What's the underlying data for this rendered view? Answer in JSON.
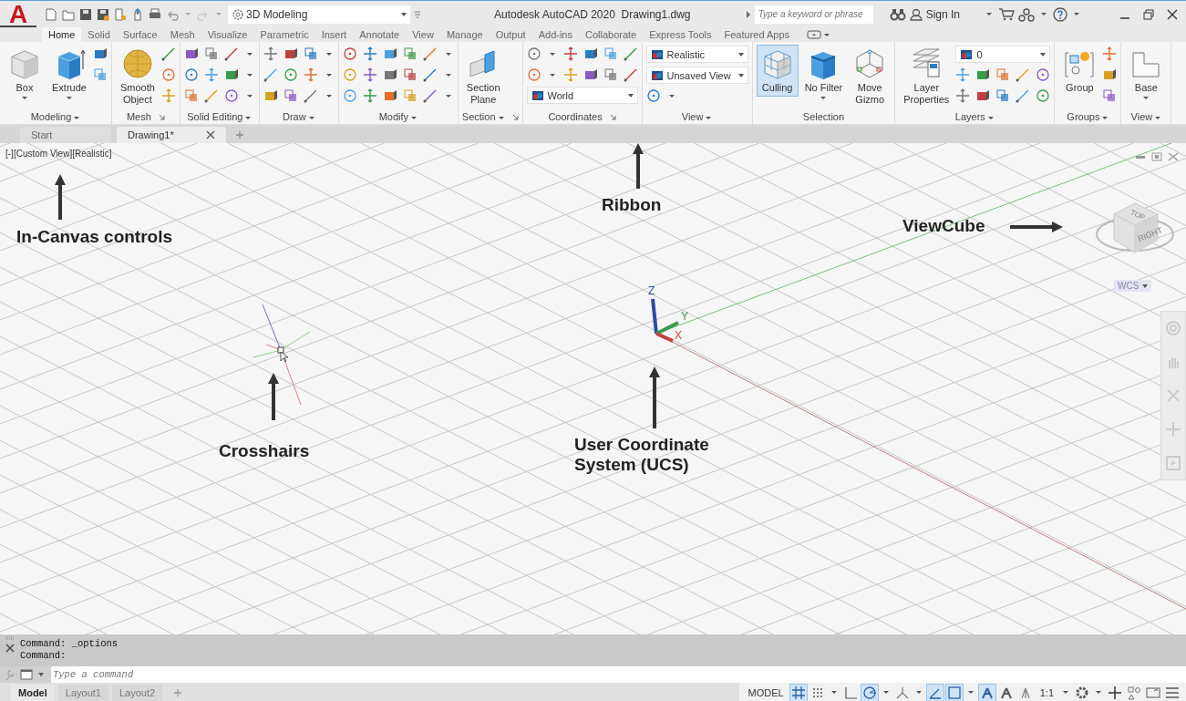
{
  "title_bar": {
    "logo": "A",
    "workspace": "3D Modeling",
    "title": "Autodesk AutoCAD 2020  Drawing1.dwg",
    "search": {
      "placeholder": "Type a keyword or phrase"
    },
    "sign_in": "Sign In"
  },
  "ribbon_tabs": [
    {
      "label": "Home",
      "selected": true
    },
    {
      "label": "Solid",
      "selected": false
    },
    {
      "label": "Surface",
      "selected": false
    },
    {
      "label": "Mesh",
      "selected": false
    },
    {
      "label": "Visualize",
      "selected": false
    },
    {
      "label": "Parametric",
      "selected": false
    },
    {
      "label": "Insert",
      "selected": false
    },
    {
      "label": "Annotate",
      "selected": false
    },
    {
      "label": "View",
      "selected": false
    },
    {
      "label": "Manage",
      "selected": false
    },
    {
      "label": "Output",
      "selected": false
    },
    {
      "label": "Add-ins",
      "selected": false
    },
    {
      "label": "Collaborate",
      "selected": false
    },
    {
      "label": "Express Tools",
      "selected": false
    },
    {
      "label": "Featured Apps",
      "selected": false
    }
  ],
  "ribbon_panels": [
    {
      "title": "Modeling",
      "dropdown": true,
      "launcher": false,
      "tools": [
        {
          "kind": "large",
          "label": "Box",
          "caret": true,
          "on": false
        },
        {
          "kind": "large",
          "label": "Extrude",
          "caret": true,
          "on": false
        },
        {
          "kind": "grid"
        }
      ]
    },
    {
      "title": "Mesh",
      "dropdown": false,
      "launcher": true,
      "tools": [
        {
          "kind": "large",
          "label": "Smooth\nObject",
          "caret": false,
          "on": false
        },
        {
          "kind": "grid"
        }
      ]
    },
    {
      "title": "Solid Editing",
      "dropdown": true,
      "launcher": false,
      "tools": [
        {
          "kind": "grid"
        }
      ]
    },
    {
      "title": "Draw",
      "dropdown": true,
      "launcher": false,
      "tools": [
        {
          "kind": "grid"
        }
      ]
    },
    {
      "title": "Modify",
      "dropdown": true,
      "launcher": false,
      "tools": [
        {
          "kind": "grid"
        }
      ]
    },
    {
      "title": "Section",
      "dropdown": true,
      "launcher": true,
      "tools": [
        {
          "kind": "large",
          "label": "Section\nPlane",
          "caret": false,
          "on": false
        }
      ]
    },
    {
      "title": "Coordinates",
      "dropdown": false,
      "launcher": true,
      "tools": [
        {
          "kind": "grid"
        },
        {
          "kind": "combo",
          "value": "World"
        }
      ]
    },
    {
      "title": "View",
      "dropdown": true,
      "launcher": false,
      "tools": [
        {
          "kind": "combo",
          "value": "Realistic"
        },
        {
          "kind": "combo",
          "value": "Unsaved View"
        },
        {
          "kind": "small"
        }
      ]
    },
    {
      "title": "Selection",
      "dropdown": false,
      "launcher": false,
      "tools": [
        {
          "kind": "large",
          "label": "Culling",
          "caret": false,
          "on": true
        },
        {
          "kind": "large",
          "label": "No Filter",
          "caret": true,
          "on": false
        },
        {
          "kind": "large",
          "label": "Move\nGizmo",
          "caret": false,
          "on": false
        }
      ]
    },
    {
      "title": "Layers",
      "dropdown": true,
      "launcher": false,
      "tools": [
        {
          "kind": "large",
          "label": "Layer\nProperties",
          "caret": false,
          "on": false
        },
        {
          "kind": "combo",
          "value": "0"
        },
        {
          "kind": "grid"
        }
      ]
    },
    {
      "title": "Groups",
      "dropdown": true,
      "launcher": false,
      "tools": [
        {
          "kind": "large",
          "label": "Group",
          "caret": false,
          "on": false
        },
        {
          "kind": "grid"
        }
      ]
    },
    {
      "title": "View",
      "dropdown": true,
      "launcher": false,
      "tools": [
        {
          "kind": "large",
          "label": "Base",
          "caret": true,
          "on": false
        }
      ]
    }
  ],
  "file_tabs": [
    {
      "label": "Start",
      "selected": false
    },
    {
      "label": "Drawing1*",
      "selected": true
    }
  ],
  "viewport": {
    "label": "[-][Custom View][Realistic]",
    "annotations": [
      {
        "label": "Ribbon"
      },
      {
        "label": "ViewCube"
      },
      {
        "label": "In-Canvas controls"
      },
      {
        "label": "Crosshairs"
      },
      {
        "label": "User Coordinate\nSystem (UCS)"
      }
    ],
    "view_cube": {
      "faces": [
        "TOP",
        "RIGHT"
      ],
      "wcs": "WCS"
    },
    "ucs_axes": [
      "Z",
      "Y",
      "X"
    ]
  },
  "command_line": {
    "history": [
      "Command: _options",
      "Command:"
    ],
    "placeholder": "Type a command"
  },
  "layout_tabs": [
    {
      "label": "Model",
      "selected": true
    },
    {
      "label": "Layout1",
      "selected": false
    },
    {
      "label": "Layout2",
      "selected": false
    }
  ],
  "status_bar": [
    {
      "kind": "label",
      "text": "MODEL"
    },
    {
      "kind": "toggle",
      "on": true
    },
    {
      "kind": "toggle",
      "on": false
    },
    {
      "kind": "caret"
    },
    {
      "kind": "toggle",
      "on": false
    },
    {
      "kind": "toggle",
      "on": true
    },
    {
      "kind": "caret"
    },
    {
      "kind": "toggle",
      "on": false
    },
    {
      "kind": "caret"
    },
    {
      "kind": "toggle",
      "on": true
    },
    {
      "kind": "toggle",
      "on": true
    },
    {
      "kind": "caret"
    },
    {
      "kind": "toggle",
      "on": true
    },
    {
      "kind": "toggle",
      "on": false
    },
    {
      "kind": "toggle",
      "on": false
    },
    {
      "kind": "label",
      "text": "1:1"
    },
    {
      "kind": "caret"
    },
    {
      "kind": "toggle",
      "on": false
    },
    {
      "kind": "caret"
    },
    {
      "kind": "toggle",
      "on": false
    },
    {
      "kind": "toggle",
      "on": false
    },
    {
      "kind": "toggle",
      "on": false
    },
    {
      "kind": "toggle",
      "on": false
    }
  ]
}
